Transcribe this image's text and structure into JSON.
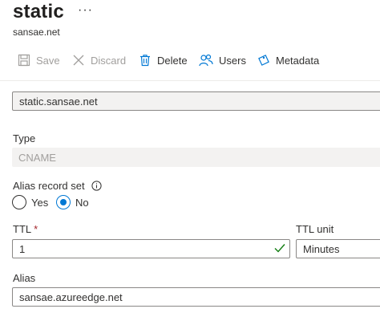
{
  "header": {
    "title": "static",
    "more": "···",
    "subtitle": "sansae.net"
  },
  "toolbar": {
    "save": "Save",
    "discard": "Discard",
    "delete": "Delete",
    "users": "Users",
    "metadata": "Metadata"
  },
  "form": {
    "name_value": "static.sansae.net",
    "type_label": "Type",
    "type_value": "CNAME",
    "alias_record_set_label": "Alias record set",
    "alias_options": [
      "Yes",
      "No"
    ],
    "alias_selected": "No",
    "ttl_label": "TTL",
    "ttl_required": "*",
    "ttl_value": "1",
    "ttl_unit_label": "TTL unit",
    "ttl_unit_value": "Minutes",
    "alias_label": "Alias",
    "alias_value": "sansae.azureedge.net"
  },
  "colors": {
    "accent": "#0078d4",
    "required": "#a4262c",
    "valid_check": "#107c10"
  }
}
